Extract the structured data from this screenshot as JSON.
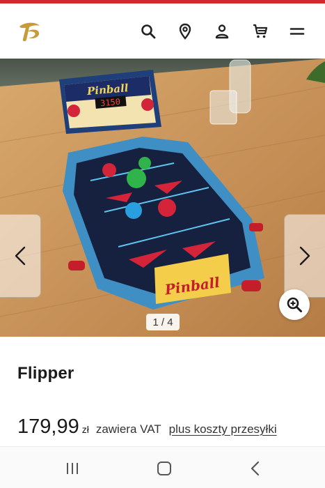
{
  "header": {
    "logo": "tchibo-logo",
    "icons": [
      "search-icon",
      "location-pin-icon",
      "account-icon",
      "cart-icon",
      "menu-icon"
    ]
  },
  "gallery": {
    "image": "pinball-product-photo",
    "board_label": "Pinball",
    "board_score": "3150",
    "counter": "1 / 4",
    "current": 1,
    "total": 4
  },
  "product": {
    "title": "Flipper",
    "price": "179,99",
    "currency": "zł",
    "vat": "zawiera VAT",
    "shipping": "plus koszty przesyłki"
  },
  "system_nav": {
    "icons": [
      "recent-apps-icon",
      "home-icon",
      "back-icon"
    ]
  },
  "colors": {
    "brand_red": "#d4282f",
    "brand_gold": "#c79a3a",
    "text": "#1a1a1a"
  }
}
